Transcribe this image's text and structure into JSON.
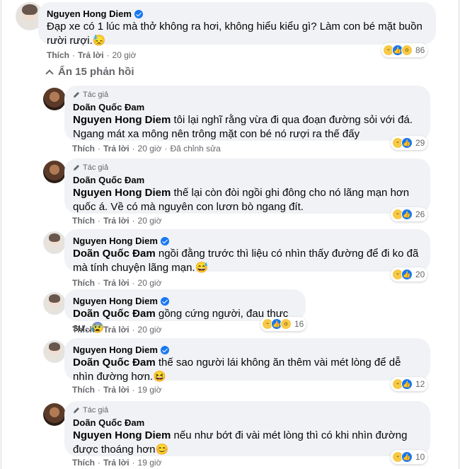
{
  "top": {
    "author": "Nguyen Hong Diem",
    "text": "Đạp xe có 1 lúc mà thở không ra hơi, không hiểu kiểu gì? Làm con bé mặt buồn rười rượi.😓",
    "like": "Thích",
    "reply": "Trả lời",
    "time": "20 giờ",
    "reaction_count": "86"
  },
  "hide_replies_label": "Ẩn 15 phản hồi",
  "author_tag": "Tác giả",
  "replies": [
    {
      "author": "Doãn Quốc Đam",
      "mention": "Nguyen Hong Diem",
      "text": " tôi lại nghĩ rằng vừa đi qua đoạn đường sỏi với đá. Ngang mát xa mông nên trông mặt con bé nó rượi ra thế đấy",
      "like": "Thích",
      "reply": "Trả lời",
      "time": "20 giờ",
      "edited": "Đã chỉnh sửa",
      "reaction_count": "29"
    },
    {
      "author": "Doãn Quốc Đam",
      "mention": "Nguyen Hong Diem",
      "text": " thế lại còn đòi ngồi ghi đông cho nó lãng mạn hơn quốc á. Về có mà nguyên con lươn bò ngang đít.",
      "like": "Thích",
      "reply": "Trả lời",
      "time": "20 giờ",
      "reaction_count": "26"
    },
    {
      "author": "Nguyen Hong Diem",
      "mention": "Doãn Quốc Đam",
      "text": " ngồi đằng trước thì liệu có nhìn thấy đường để đi ko đã mà tính chuyện lãng mạn.😅",
      "like": "Thích",
      "reply": "Trả lời",
      "time": "20 giờ",
      "reaction_count": "20"
    },
    {
      "author": "Nguyen Hong Diem",
      "mention": "Doãn Quốc Đam",
      "text": " gồng cứng người, đau thực sự..😰",
      "like": "Thích",
      "reply": "Trả lời",
      "time": "20 giờ",
      "reaction_count": "16"
    },
    {
      "author": "Nguyen Hong Diem",
      "mention": "Doãn Quốc Đam",
      "text": " thế sao người lái không ăn thêm vài mét lòng để dễ nhìn đường hơn.😆",
      "like": "Thích",
      "reply": "Trả lời",
      "time": "19 giờ",
      "reaction_count": "12"
    },
    {
      "author": "Doãn Quốc Đam",
      "mention": "Nguyen Hong Diem",
      "text": " nếu như bớt đi vài mét lòng thì có khi nhìn đường được thoáng hơn😊",
      "like": "Thích",
      "reply": "Trả lời",
      "time": "19 giờ",
      "reaction_count": "10"
    }
  ],
  "colors": {
    "bubble": "#f0f2f5",
    "meta": "#65676b",
    "verified": "#1877f2",
    "haha": "#f7c945",
    "like": "#1877f2"
  },
  "icons": {
    "verified": "verified-badge-icon",
    "pen": "pencil-icon",
    "haha": "haha-reaction-icon",
    "like": "like-reaction-icon",
    "wow": "wow-reaction-icon",
    "chevron": "chevron-up-icon"
  }
}
